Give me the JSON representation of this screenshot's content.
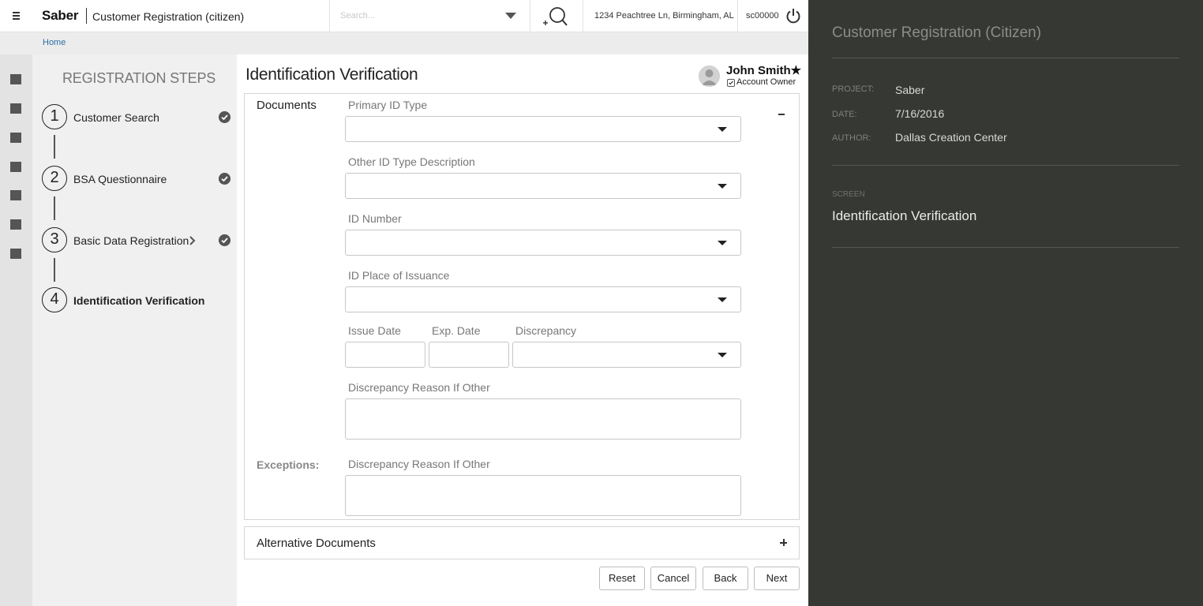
{
  "header": {
    "brand": "Saber",
    "app_title": "Customer Registration (citizen)",
    "search_placeholder": "Search...",
    "address": "1234 Peachtree Ln, Birmingham, AL",
    "user_id": "sc00000",
    "icons": [
      "menu-icon",
      "search-plus-icon",
      "power-icon"
    ]
  },
  "breadcrumb": {
    "home": "Home"
  },
  "rail": {
    "icons": [
      "nav-square-icon",
      "nav-square-icon",
      "nav-square-icon",
      "nav-square-icon",
      "nav-square-icon",
      "nav-square-icon",
      "nav-square-icon"
    ]
  },
  "steps": {
    "title": "REGISTRATION STEPS",
    "items": [
      {
        "number": "1",
        "label": "Customer Search",
        "complete": true,
        "active": false
      },
      {
        "number": "2",
        "label": "BSA Questionnaire",
        "complete": true,
        "active": false
      },
      {
        "number": "3",
        "label": "Basic Data Registration",
        "complete": true,
        "active": false
      },
      {
        "number": "4",
        "label": "Identification Verification",
        "complete": false,
        "active": true
      }
    ]
  },
  "main": {
    "page_title": "Identification Verification",
    "customer": {
      "name": "John Smith★",
      "owner_label": "Account Owner",
      "owner_checked": true
    },
    "documents": {
      "title": "Documents",
      "fields": {
        "primary_id_type": {
          "label": "Primary ID Type",
          "value": ""
        },
        "other_id_type_description": {
          "label": "Other ID Type Description",
          "value": ""
        },
        "id_number": {
          "label": "ID Number",
          "value": ""
        },
        "id_place_of_issuance": {
          "label": "ID Place of Issuance",
          "value": ""
        },
        "issue_date": {
          "label": "Issue Date",
          "value": ""
        },
        "exp_date": {
          "label": "Exp. Date",
          "value": ""
        },
        "discrepancy": {
          "label": "Discrepancy",
          "value": ""
        },
        "discrepancy_reason": {
          "label": "Discrepancy Reason If Other",
          "value": ""
        }
      },
      "exceptions": {
        "label": "Exceptions:",
        "reason_label": "Discrepancy Reason If Other",
        "value": ""
      }
    },
    "alternative_documents": {
      "title": "Alternative Documents"
    },
    "buttons": {
      "reset": "Reset",
      "cancel": "Cancel",
      "back": "Back",
      "next": "Next"
    }
  },
  "info_panel": {
    "title": "Customer Registration (Citizen)",
    "project_key": "PROJECT:",
    "project_val": "Saber",
    "date_key": "DATE:",
    "date_val": "7/16/2016",
    "author_key": "AUTHOR:",
    "author_val": "Dallas Creation Center",
    "screen_key": "SCREEN",
    "screen_val": "Identification Verification"
  },
  "colors": {
    "info_panel_bg": "#363834",
    "link": "#2b6ea8",
    "rail_bg": "#e3e3e3",
    "steps_bg": "#f0f0f0"
  }
}
